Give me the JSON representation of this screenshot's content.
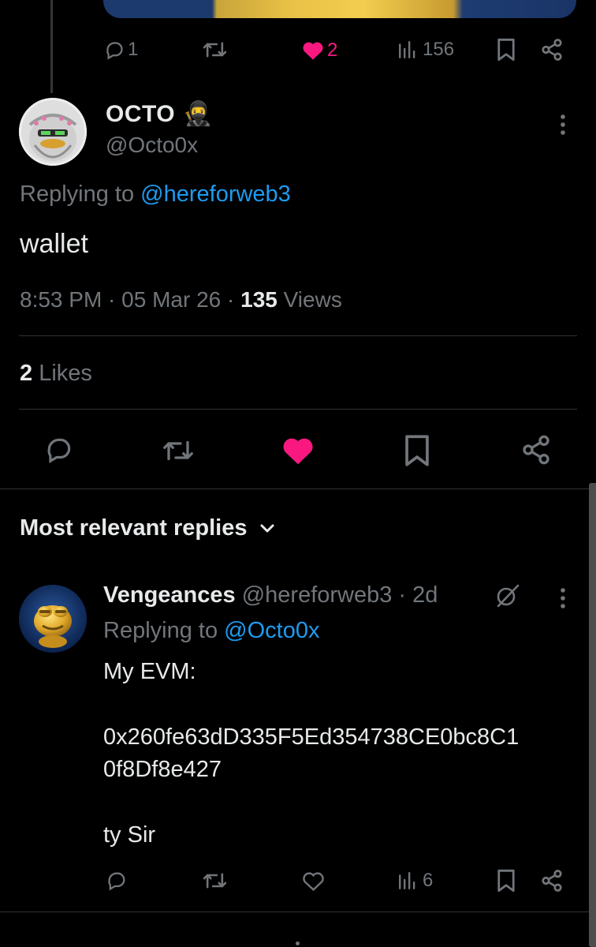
{
  "parent_tweet": {
    "actions": {
      "reply_count": "1",
      "like_count": "2",
      "views_count": "156"
    }
  },
  "main_tweet": {
    "author": {
      "name": "OCTO",
      "emoji": "🥷",
      "handle": "@Octo0x"
    },
    "replying_prefix": "Replying to",
    "replying_handle": "@hereforweb3",
    "text": "wallet",
    "time": "8:53 PM",
    "date": "05 Mar 26",
    "views_count": "135",
    "views_label": "Views",
    "likes_count": "2",
    "likes_label": "Likes"
  },
  "replies_header": {
    "label": "Most relevant replies"
  },
  "reply": {
    "author": {
      "name": "Vengeances",
      "handle": "@hereforweb3",
      "time": "2d"
    },
    "replying_prefix": "Replying to",
    "replying_handle": "@Octo0x",
    "lines": [
      "My EVM:",
      "0x260fe63dD335F5Ed354738CE0bc8C1",
      "0f8Df8e427",
      "ty Sir"
    ],
    "actions": {
      "views_count": "6"
    }
  },
  "colors": {
    "background": "#000000",
    "text": "#e7e9ea",
    "secondary": "#71767b",
    "link": "#1d9bf0",
    "like": "#f91880",
    "divider": "#2f3336"
  }
}
